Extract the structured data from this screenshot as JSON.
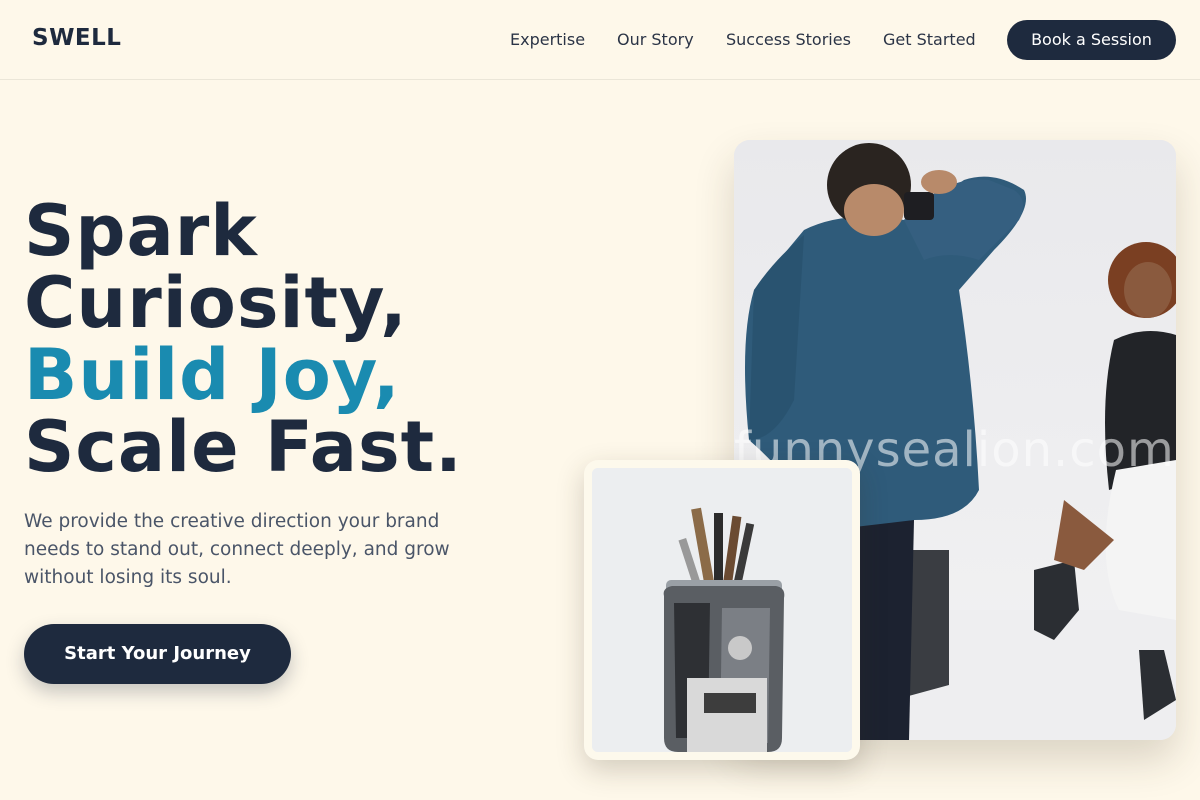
{
  "header": {
    "logo": "SWELL",
    "nav": [
      "Expertise",
      "Our Story",
      "Success Stories",
      "Get Started"
    ],
    "cta": "Book a Session"
  },
  "hero": {
    "title_line1": "Spark",
    "title_line2": "Curiosity,",
    "title_accent": "Build Joy,",
    "title_line4": "Scale Fast.",
    "subtitle": "We provide the creative direction your brand needs to stand out, connect deeply, and grow without losing its soul.",
    "cta": "Start Your Journey"
  },
  "images": {
    "main_watermark": "funnysealion.com"
  },
  "colors": {
    "background": "#fef8ea",
    "navy": "#1e2a3e",
    "accent": "#1a8bb0"
  }
}
